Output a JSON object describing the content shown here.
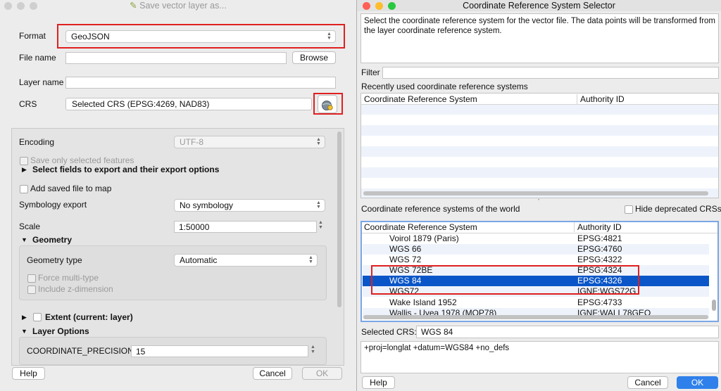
{
  "left": {
    "title": "Save vector layer as...",
    "format_label": "Format",
    "format_value": "GeoJSON",
    "filename_label": "File name",
    "filename_value": "",
    "browse": "Browse",
    "layername_label": "Layer name",
    "layername_value": "",
    "crs_label": "CRS",
    "crs_value": "Selected CRS (EPSG:4269, NAD83)",
    "encoding_label": "Encoding",
    "encoding_value": "UTF-8",
    "save_selected": "Save only selected features",
    "select_fields": "Select fields to export and their export options",
    "add_saved": "Add saved file to map",
    "symbology_label": "Symbology export",
    "symbology_value": "No symbology",
    "scale_label": "Scale",
    "scale_value": "1:50000",
    "geometry_header": "Geometry",
    "geometry_type_label": "Geometry type",
    "geometry_type_value": "Automatic",
    "force_multi": "Force multi-type",
    "include_z": "Include z-dimension",
    "extent": "Extent (current: layer)",
    "layer_options": "Layer Options",
    "coord_precision_label": "COORDINATE_PRECISION",
    "coord_precision_value": "15",
    "help": "Help",
    "cancel": "Cancel",
    "ok": "OK"
  },
  "right": {
    "title": "Coordinate Reference System Selector",
    "description": "Select the coordinate reference system for the vector file. The data points will be transformed from the layer coordinate reference system.",
    "filter_label": "Filter",
    "filter_value": "",
    "recent_label": "Recently used coordinate reference systems",
    "col_crs": "Coordinate Reference System",
    "col_auth": "Authority ID",
    "world_label": "Coordinate reference systems of the world",
    "hide_deprecated": "Hide deprecated CRSs",
    "world_rows": [
      {
        "name": "Voirol 1879 (Paris)",
        "id": "EPSG:4821"
      },
      {
        "name": "WGS 66",
        "id": "EPSG:4760"
      },
      {
        "name": "WGS 72",
        "id": "EPSG:4322"
      },
      {
        "name": "WGS 72BE",
        "id": "EPSG:4324"
      },
      {
        "name": "WGS 84",
        "id": "EPSG:4326"
      },
      {
        "name": "WGS72",
        "id": "IGNF:WGS72G"
      },
      {
        "name": "Wake Island 1952",
        "id": "EPSG:4733"
      },
      {
        "name": "Wallis - Uvea 1978 (MOP78)",
        "id": "IGNF:WALL78GEO"
      }
    ],
    "selected_crs_label": "Selected CRS:",
    "selected_crs_value": "WGS 84",
    "proj_string": "+proj=longlat +datum=WGS84 +no_defs",
    "help": "Help",
    "cancel": "Cancel",
    "ok": "OK"
  },
  "colors": {
    "highlight": "#0a56c8",
    "annotation": "#e02020",
    "ok_button": "#2f80ea"
  }
}
